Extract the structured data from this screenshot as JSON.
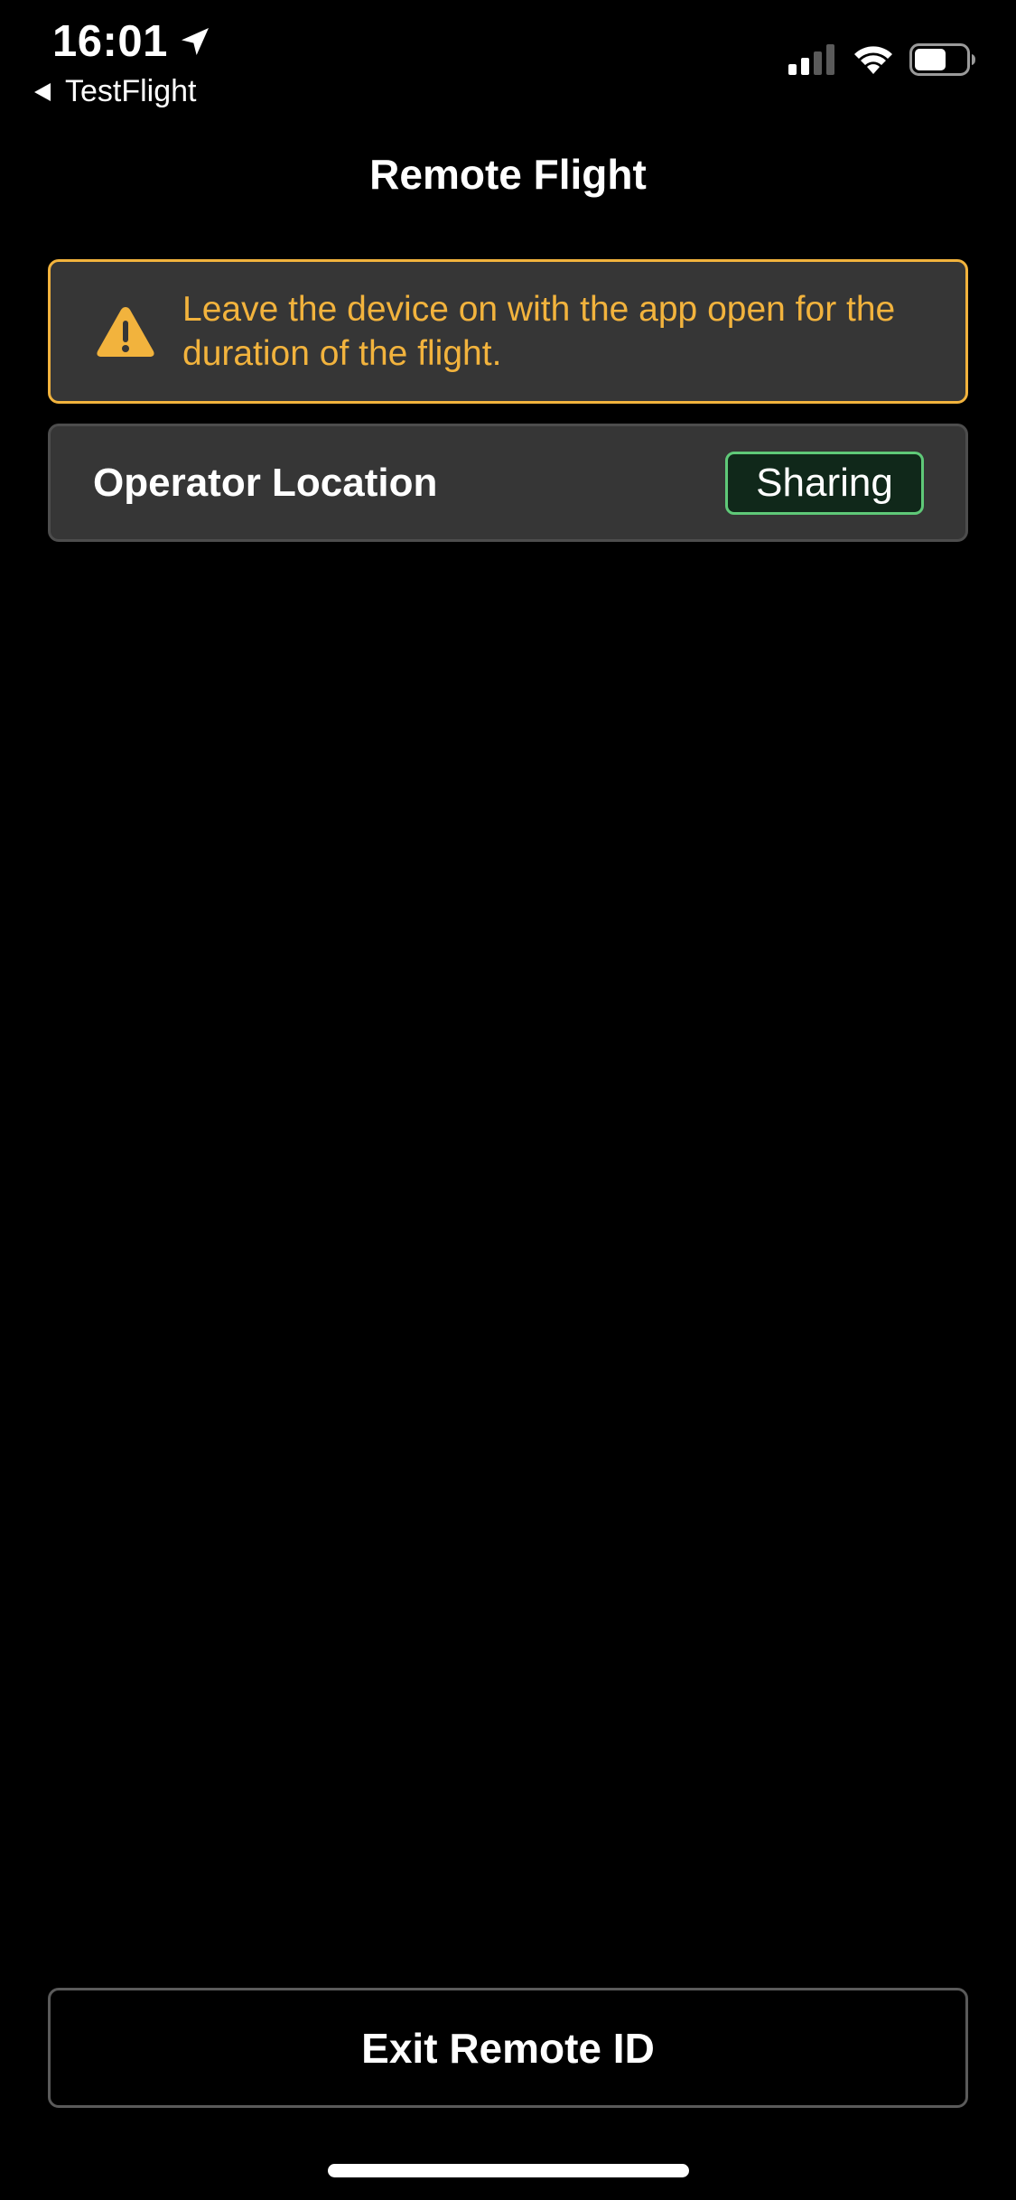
{
  "status_bar": {
    "time": "16:01",
    "back_app_label": "TestFlight",
    "icons": [
      "location-arrow-icon",
      "cellular-signal-icon",
      "wifi-icon",
      "battery-icon"
    ]
  },
  "nav": {
    "title": "Remote Flight"
  },
  "warning": {
    "icon": "warning-triangle-icon",
    "text": "Leave the device on with the app open for the duration of the flight.",
    "color": "#f2b33d"
  },
  "operator_location": {
    "label": "Operator Location",
    "status": "Sharing",
    "status_color": "#5fc978"
  },
  "actions": {
    "exit_label": "Exit Remote ID"
  },
  "colors": {
    "background": "#000000",
    "card": "#363636",
    "accent_warning": "#f2b33d",
    "accent_success": "#5fc978"
  }
}
